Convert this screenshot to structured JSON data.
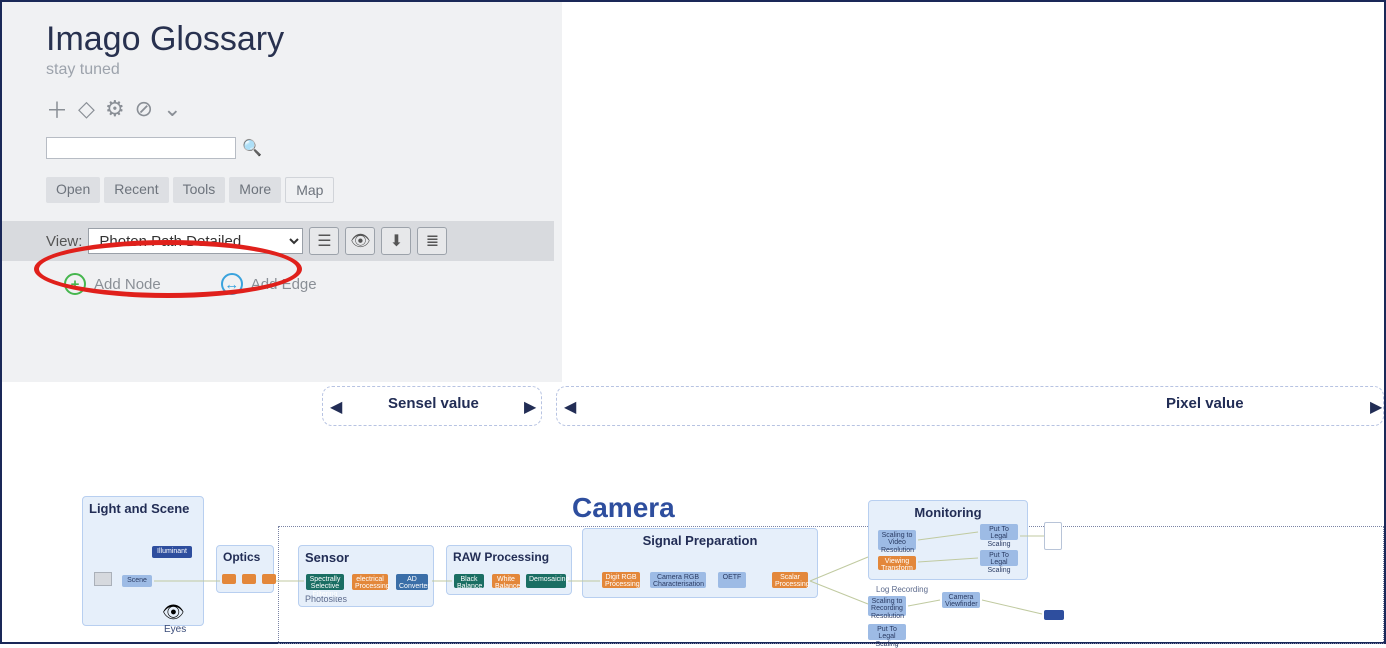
{
  "sidebar": {
    "title": "Imago Glossary",
    "subtitle": "stay tuned",
    "search_placeholder": "",
    "tabs": [
      "Open",
      "Recent",
      "Tools",
      "More",
      "Map"
    ],
    "active_tab": "Map",
    "view_label": "View:",
    "view_value": "Photon Path Detailed",
    "add_node": "Add Node",
    "add_edge": "Add Edge"
  },
  "diagram": {
    "groups": {
      "sensel": "Sensel value",
      "pixel": "Pixel value"
    },
    "camera_title": "Camera",
    "regions": {
      "light": "Light and Scene",
      "optics": "Optics",
      "sensor": "Sensor",
      "sensor_sub": "Photosites",
      "raw": "RAW Processing",
      "signal": "Signal Preparation",
      "monitor": "Monitoring"
    },
    "nodes": {
      "illuminant": "Illuminant",
      "scene": "Scene",
      "eyes": "Eyes",
      "spectrally": "Spectrally Selective Filtering",
      "electrical": "electrical Processing",
      "ad": "AD Converter",
      "black": "Black Balance",
      "white": "White Balance",
      "demosaic": "Demosaicing",
      "digrgb": "Digit RGB Processing",
      "camrgb": "Camera RGB Characterisation",
      "oetf": "OETF",
      "scalar": "Scalar Processing",
      "scale_vid": "Scaling to Video Resolution",
      "view_trans": "Viewing Transform",
      "put_legal1": "Put To Legal Scaling",
      "put_legal2": "Put To Legal Scaling",
      "scale_rec": "Scaling to Recording Resolution",
      "cam_view": "Camera Viewfinder",
      "put_legal3": "Put To Legal Scaling",
      "log_rec": "Log Recording"
    }
  }
}
